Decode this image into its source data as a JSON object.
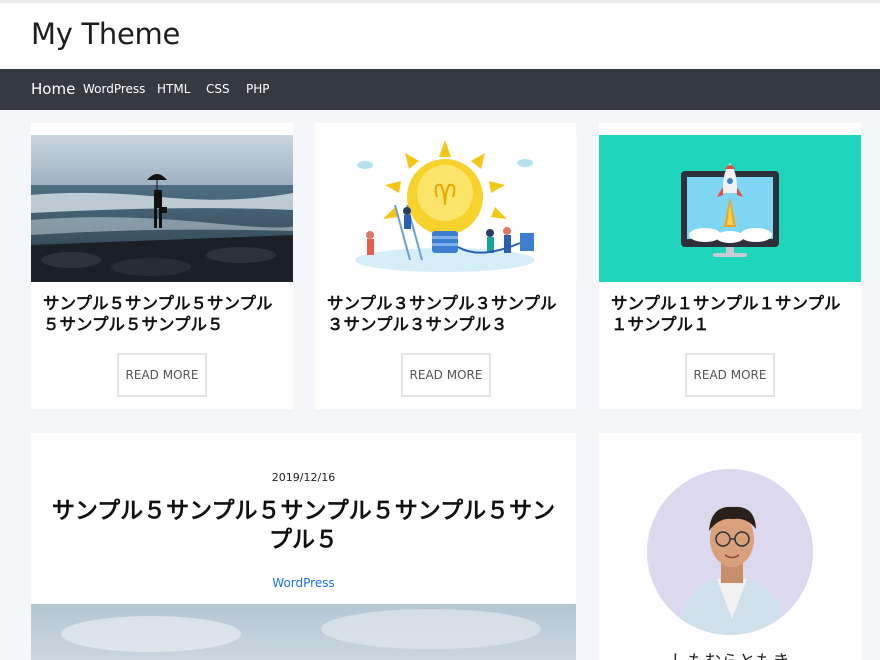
{
  "site": {
    "title": "My Theme"
  },
  "nav": {
    "items": [
      {
        "label": "Home"
      },
      {
        "label": "WordPress"
      },
      {
        "label": "HTML"
      },
      {
        "label": "CSS"
      },
      {
        "label": "PHP"
      }
    ]
  },
  "cards": [
    {
      "title": "サンプル５サンプル５サンプル５サンプル５サンプル５",
      "button": "READ MORE",
      "image": "man-with-umbrella-at-sea"
    },
    {
      "title": "サンプル３サンプル３サンプル３サンプル３サンプル３",
      "button": "READ MORE",
      "image": "lightbulb-illustration"
    },
    {
      "title": "サンプル１サンプル１サンプル１サンプル１",
      "button": "READ MORE",
      "image": "rocket-monitor-illustration"
    }
  ],
  "post": {
    "date": "2019/12/16",
    "title": "サンプル５サンプル５サンプル５サンプル５サンプル５",
    "category": "WordPress"
  },
  "profile": {
    "name": "しもむらともき"
  },
  "colors": {
    "nav_bg": "#343a40",
    "accent_teal": "#1fd5bc",
    "link": "#1a73e8"
  }
}
